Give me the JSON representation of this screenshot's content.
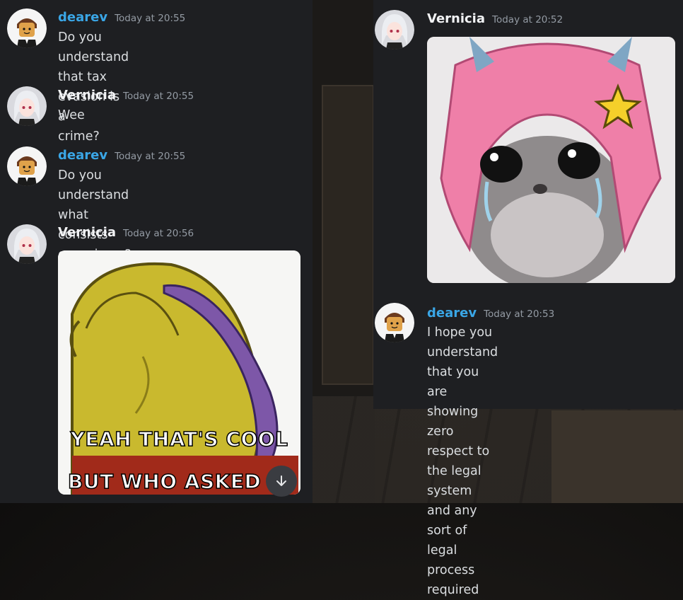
{
  "left": {
    "messages": [
      {
        "author": "dearev",
        "time": "Today at 20:55",
        "lines": [
          "Do you understand that tax evasion is a",
          "crime?"
        ]
      },
      {
        "author": "Vernicia",
        "time": "Today at 20:55",
        "lines": [
          "Wee"
        ]
      },
      {
        "author": "dearev",
        "time": "Today at 20:55",
        "lines": [
          "Do you understand what consists",
          "conspiracy?"
        ]
      },
      {
        "author": "Vernicia",
        "time": "Today at 20:56",
        "image": {
          "caption_top": "YEAH THAT'S COOL",
          "caption_bottom": "BUT WHO ASKED"
        }
      }
    ],
    "jump_icon": "arrow-down-icon"
  },
  "right": {
    "messages": [
      {
        "author": "Vernicia",
        "time": "Today at 20:52",
        "image": {
          "kind": "crying-hamster-with-pink-hair"
        }
      },
      {
        "author": "dearev",
        "time": "Today at 20:53",
        "lines": [
          "I hope you understand that you are",
          "showing zero respect to the legal",
          "system and any sort of legal process",
          "required"
        ]
      }
    ]
  },
  "colors": {
    "panel": "#1e1f22",
    "dearev_name": "#3aa6e6",
    "timestamp": "#949ba4",
    "text": "#dbdee1"
  }
}
